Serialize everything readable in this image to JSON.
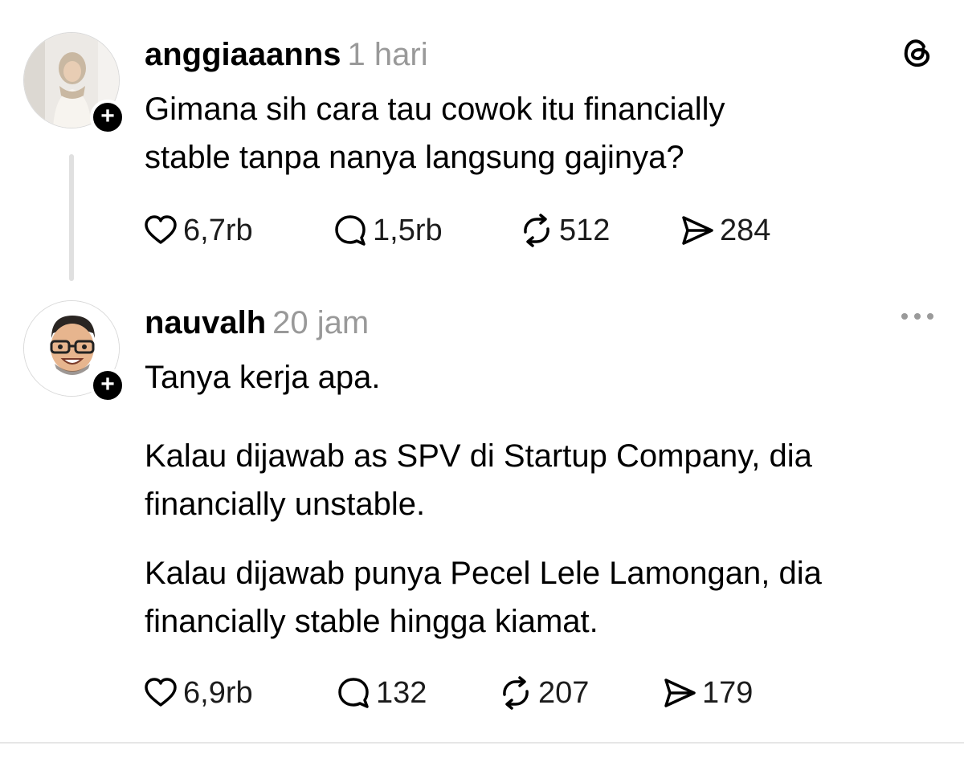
{
  "posts": [
    {
      "username": "anggiaaanns",
      "time": "1 hari",
      "lines": [
        "Gimana sih cara tau cowok itu financially",
        "stable tanpa nanya langsung gajinya?"
      ],
      "likes": "6,7rb",
      "replies": "1,5rb",
      "reposts": "512",
      "shares": "284",
      "corner_icon": "threads-logo-icon"
    },
    {
      "username": "nauvalh",
      "time": "20 jam",
      "paragraphs": [
        "Tanya kerja apa.",
        "Kalau dijawab as SPV di Startup Company, dia financially unstable.",
        "Kalau dijawab punya Pecel Lele Lamongan, dia financially stable hingga kiamat."
      ],
      "likes": "6,9rb",
      "replies": "132",
      "reposts": "207",
      "shares": "179",
      "corner_icon": "more-options-icon"
    }
  ],
  "follow_badge": "+",
  "colors": {
    "text": "#000000",
    "muted": "#999999",
    "thread_line": "#e0e0e0"
  }
}
